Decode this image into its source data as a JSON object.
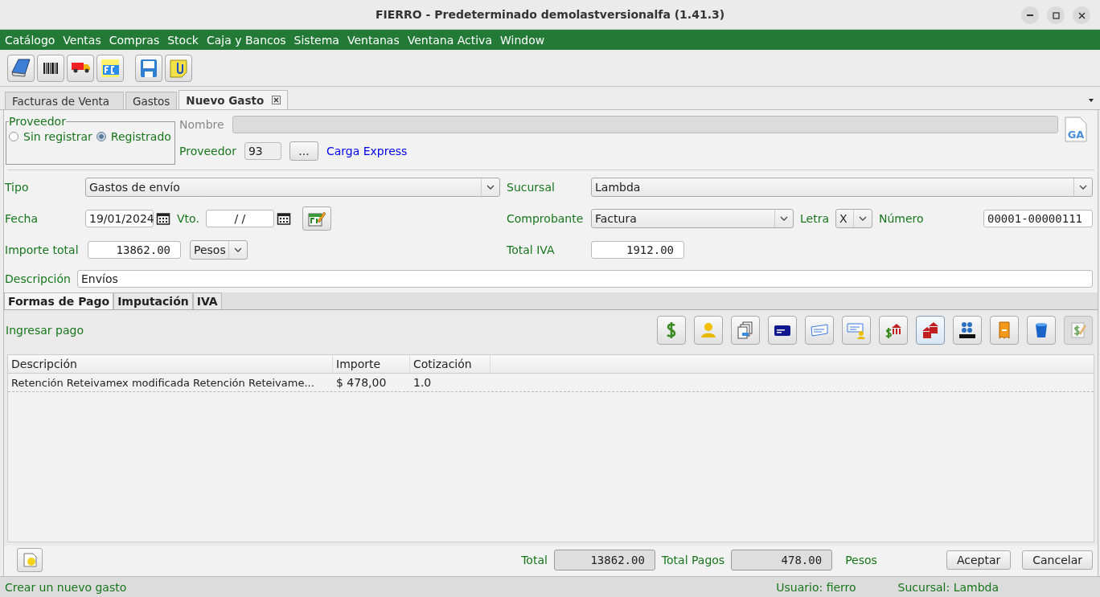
{
  "window": {
    "title": "FIERRO - Predeterminado demolastversionalfa (1.41.3)"
  },
  "menu": [
    "Catálogo",
    "Ventas",
    "Compras",
    "Stock",
    "Caja y Bancos",
    "Sistema",
    "Ventanas",
    "Ventana Activa",
    "Window"
  ],
  "toolbar": [
    [
      {
        "kind": "book"
      },
      {
        "kind": "barcode"
      },
      {
        "kind": "truck"
      },
      {
        "kind": "fc"
      }
    ],
    [
      {
        "kind": "save"
      },
      {
        "kind": "note"
      }
    ]
  ],
  "tabs": [
    {
      "label": "Facturas de Venta",
      "selected": false,
      "closable": false
    },
    {
      "label": "Gastos",
      "selected": false,
      "closable": false
    },
    {
      "label": "Nuevo Gasto",
      "selected": true,
      "closable": true
    }
  ],
  "proveedor": {
    "legend": "Proveedor",
    "options": [
      {
        "label": "Sin registrar",
        "selected": false
      },
      {
        "label": "Registrado",
        "selected": true
      }
    ],
    "nombre_label": "Nombre",
    "nombre_disabled": true,
    "code_label": "Proveedor",
    "code": "93",
    "browse": "...",
    "name": "Carga Express",
    "badge": "GA"
  },
  "form": {
    "tipo": {
      "label": "Tipo",
      "value": "Gastos de envío"
    },
    "sucursal": {
      "label": "Sucursal",
      "value": "Lambda"
    },
    "fecha": {
      "label": "Fecha",
      "value": "19/01/2024"
    },
    "vto": {
      "label": "Vto.",
      "value": "/ /"
    },
    "comprobante": {
      "label": "Comprobante",
      "value": "Factura"
    },
    "letra": {
      "label": "Letra",
      "value": "X"
    },
    "numero": {
      "label": "Número",
      "value": "00001-00000111"
    },
    "importe": {
      "label": "Importe total",
      "value": "13862.00",
      "currency": "Pesos"
    },
    "total_iva": {
      "label": "Total IVA",
      "value": "1912.00"
    },
    "descripcion": {
      "label": "Descripción",
      "value": "Envíos"
    }
  },
  "subtabs": [
    {
      "label": "Formas de Pago",
      "selected": true
    },
    {
      "label": "Imputación",
      "selected": false
    },
    {
      "label": "IVA",
      "selected": false
    }
  ],
  "payment": {
    "label": "Ingresar pago",
    "buttons": [
      {
        "kind": "dollar",
        "highlighted": false,
        "disabled": false
      },
      {
        "kind": "person",
        "highlighted": false,
        "disabled": false
      },
      {
        "kind": "documents",
        "highlighted": false,
        "disabled": false
      },
      {
        "kind": "card",
        "highlighted": false,
        "disabled": false
      },
      {
        "kind": "cheque",
        "highlighted": false,
        "disabled": false
      },
      {
        "kind": "cheque-person",
        "highlighted": false,
        "disabled": false
      },
      {
        "kind": "dollar-bank",
        "highlighted": false,
        "disabled": false
      },
      {
        "kind": "banks",
        "highlighted": true,
        "disabled": false
      },
      {
        "kind": "sat",
        "highlighted": false,
        "disabled": false
      },
      {
        "kind": "receipt",
        "highlighted": false,
        "disabled": false
      },
      {
        "kind": "bin",
        "highlighted": false,
        "disabled": false
      },
      {
        "kind": "dollar-edit",
        "highlighted": false,
        "disabled": true
      }
    ]
  },
  "table": {
    "columns": [
      "Descripción",
      "Importe",
      "Cotización"
    ],
    "rows": [
      [
        "Retención Reteivamex modificada Retención Reteivame...",
        "$ 478,00",
        "1.0"
      ]
    ]
  },
  "footer": {
    "total_label": "Total",
    "total": "13862.00",
    "pagos_label": "Total Pagos",
    "pagos": "478.00",
    "currency": "Pesos",
    "buttons": [
      "Aceptar",
      "Cancelar"
    ]
  },
  "status_bar": {
    "message": "Crear un nuevo gasto",
    "user": "Usuario: fierro",
    "sucursal": "Sucursal: Lambda"
  }
}
